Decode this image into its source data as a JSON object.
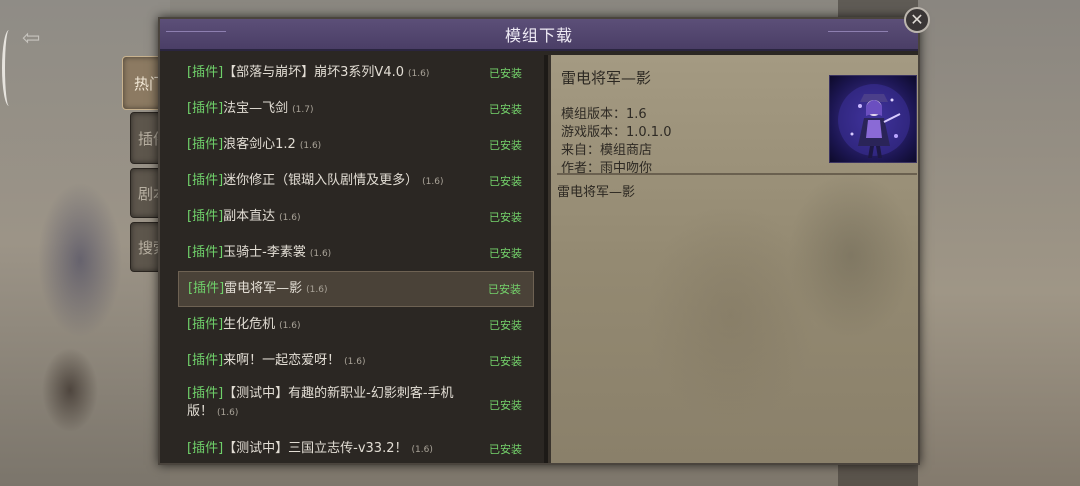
{
  "window": {
    "title": "模组下载"
  },
  "side_tabs": [
    "热门",
    "插件",
    "剧本",
    "搜索"
  ],
  "mods": [
    {
      "tag": "[插件]",
      "name": "【部落与崩坏】崩坏3系列V4.0",
      "version": "(1.6)",
      "status": "已安装"
    },
    {
      "tag": "[插件]",
      "name": "法宝—飞剑",
      "version": "(1.7)",
      "status": "已安装"
    },
    {
      "tag": "[插件]",
      "name": "浪客剑心1.2",
      "version": "(1.6)",
      "status": "已安装"
    },
    {
      "tag": "[插件]",
      "name": "迷你修正（银瑚入队剧情及更多）",
      "version": "(1.6)",
      "status": "已安装"
    },
    {
      "tag": "[插件]",
      "name": "副本直达",
      "version": "(1.6)",
      "status": "已安装"
    },
    {
      "tag": "[插件]",
      "name": "玉骑士-李素裳",
      "version": "(1.6)",
      "status": "已安装"
    },
    {
      "tag": "[插件]",
      "name": "雷电将军—影",
      "version": "(1.6)",
      "status": "已安装"
    },
    {
      "tag": "[插件]",
      "name": "生化危机",
      "version": "(1.6)",
      "status": "已安装"
    },
    {
      "tag": "[插件]",
      "name": "来啊！一起恋爱呀！",
      "version": "(1.6)",
      "status": "已安装"
    },
    {
      "tag": "[插件]",
      "name": "【测试中】有趣的新职业-幻影刺客-手机版！",
      "version": "(1.6)",
      "status": "已安装"
    },
    {
      "tag": "[插件]",
      "name": "【测试中】三国立志传-v33.2！",
      "version": "(1.6)",
      "status": "已安装"
    }
  ],
  "detail": {
    "name": "雷电将军—影",
    "mod_version": "模组版本：1.6",
    "game_version": "游戏版本：1.0.1.0",
    "source": "来自：模组商店",
    "author": "作者：雨中吻你",
    "description": "雷电将军—影"
  }
}
